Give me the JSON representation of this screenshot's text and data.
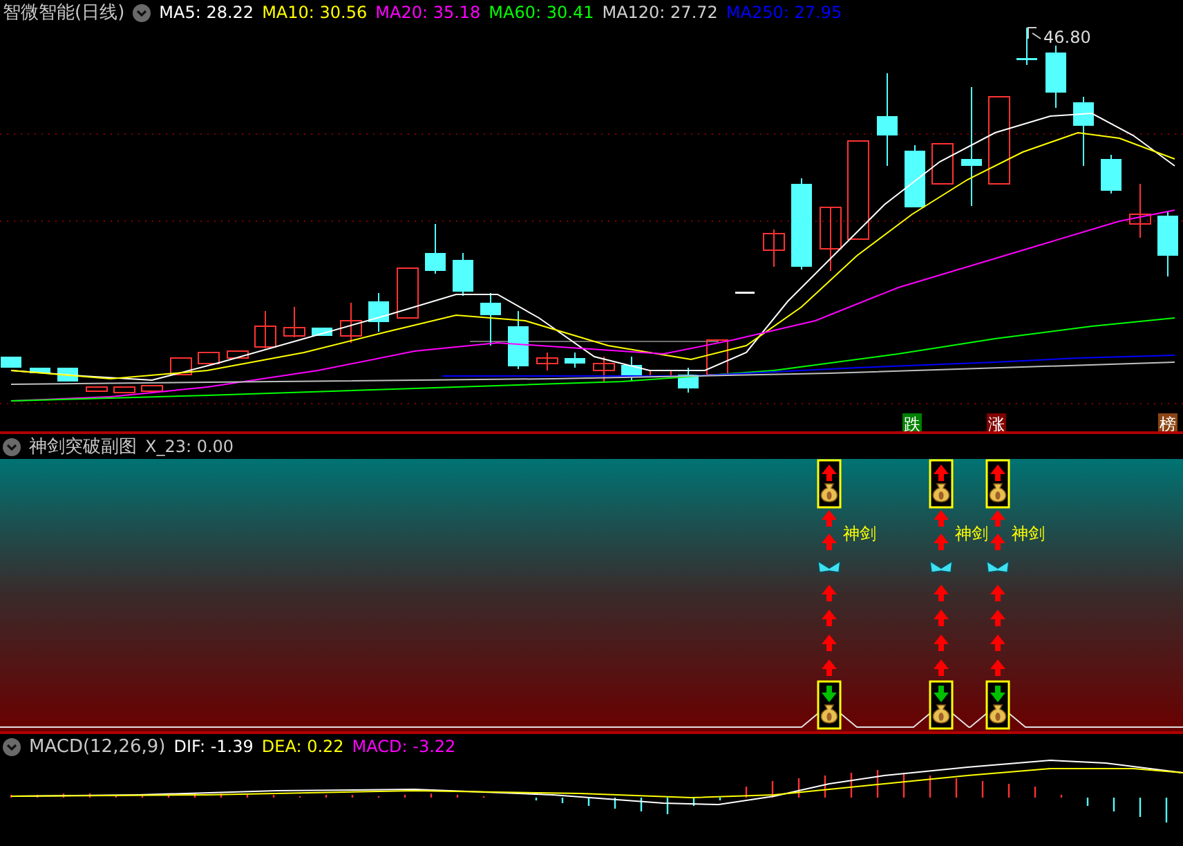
{
  "main_panel": {
    "title": "智微智能(日线)",
    "indicators": [
      {
        "label": "MA5: 28.22",
        "color": "#ffffff"
      },
      {
        "label": "MA10: 30.56",
        "color": "#ffff00"
      },
      {
        "label": "MA20: 35.18",
        "color": "#ff00ff"
      },
      {
        "label": "MA60: 30.41",
        "color": "#00ff00"
      },
      {
        "label": "MA120: 27.72",
        "color": "#d0d0d0"
      },
      {
        "label": "MA250: 27.95",
        "color": "#0000ff"
      }
    ],
    "high_label": "46.80",
    "badges": [
      {
        "text": "跌",
        "color": "#008000"
      },
      {
        "text": "涨",
        "color": "#800000"
      },
      {
        "text": "榜",
        "color": "#8b4513"
      }
    ]
  },
  "sub_panel": {
    "title": "神剑突破副图",
    "value": "X_23: 0.00",
    "signals": [
      {
        "label": "神剑"
      },
      {
        "label": "神剑"
      },
      {
        "label": "神剑"
      }
    ]
  },
  "macd_panel": {
    "title": "MACD(12,26,9)",
    "indicators": [
      {
        "label": "DIF: -1.39",
        "color": "#ffffff"
      },
      {
        "label": "DEA: 0.22",
        "color": "#ffff00"
      },
      {
        "label": "MACD: -3.22",
        "color": "#ff00ff"
      }
    ]
  }
}
